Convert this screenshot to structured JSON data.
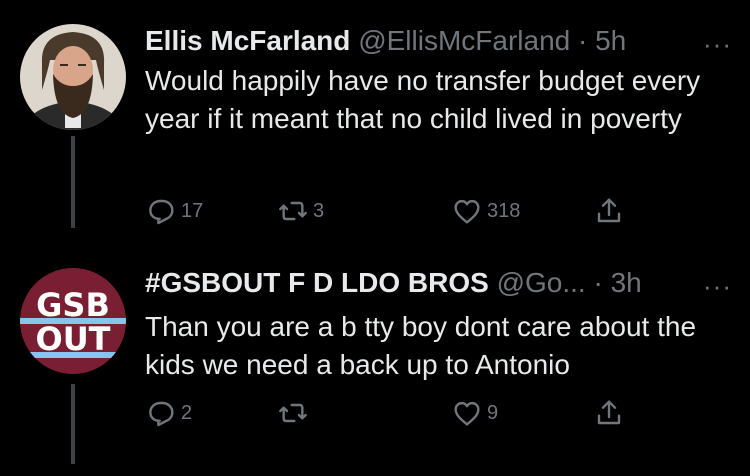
{
  "tweets": [
    {
      "name": "Ellis McFarland",
      "handle": "@EllisMcFarland",
      "time": "5h",
      "text": "Would happily have no transfer budget every year if it meant that no child lived in poverty",
      "replies": "17",
      "retweets": "3",
      "likes": "318",
      "more": "···"
    },
    {
      "name": "#GSBOUT F D LDO BROS",
      "handle": "@Go...",
      "time": "3h",
      "text": "Than you are a b  tty boy dont care about the kids we need a back up to Antonio",
      "replies": "2",
      "retweets": "",
      "likes": "9",
      "more": "···",
      "avatar_text_line1": "GSB",
      "avatar_text_line2": "OUT"
    }
  ],
  "colors": {
    "background": "#000000",
    "text": "#e7e9ea",
    "muted": "#71767b",
    "gsb_maroon": "#7a1f33",
    "gsb_blue": "#86c6ea"
  }
}
